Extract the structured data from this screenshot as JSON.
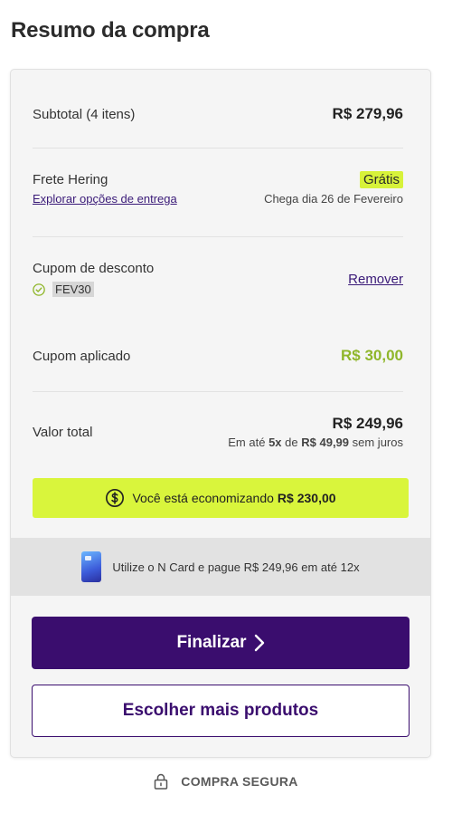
{
  "page_title": "Resumo da compra",
  "subtotal": {
    "label": "Subtotal (4 itens)",
    "value": "R$ 279,96"
  },
  "shipping": {
    "label": "Frete Hering",
    "options_link": "Explorar opções de entrega",
    "price_badge": "Grátis",
    "arrival": "Chega dia 26 de Fevereiro"
  },
  "coupon": {
    "label": "Cupom de desconto",
    "code": "FEV30",
    "remove_label": "Remover",
    "icon": "check-circle-icon"
  },
  "applied": {
    "label": "Cupom aplicado",
    "value": "R$ 30,00"
  },
  "total": {
    "label": "Valor total",
    "value": "R$ 249,96",
    "installments_prefix": "Em até",
    "installments_count": "5x",
    "installments_mid": "de",
    "installments_value": "R$ 49,99",
    "installments_suffix": "sem juros"
  },
  "savings": {
    "text": "Você está economizando",
    "amount": "R$ 230,00",
    "icon": "dollar-circle-icon"
  },
  "ncard": {
    "text": "Utilize o N Card e pague R$ 249,96 em até 12x",
    "icon": "n-card-icon"
  },
  "buttons": {
    "finalize_label": "Finalizar",
    "more_products_label": "Escolher mais produtos"
  },
  "secure": {
    "label": "COMPRA SEGURA",
    "icon": "lock-icon"
  },
  "colors": {
    "primary": "#3a0d6e",
    "accent_lime": "#d9f53c",
    "discount_green": "#8fb62a",
    "card_bg": "#f5f5f5"
  }
}
